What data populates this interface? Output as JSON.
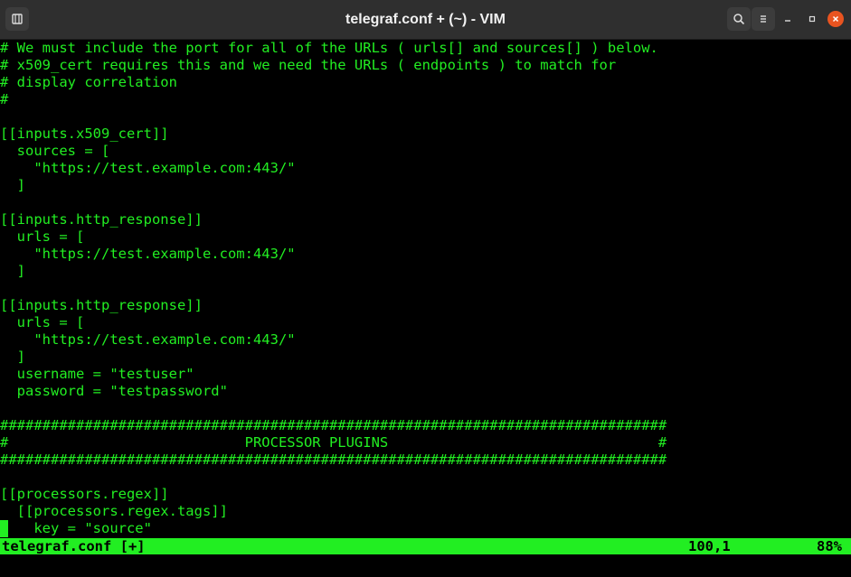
{
  "window": {
    "title": "telegraf.conf + (~) - VIM"
  },
  "icons": {
    "new_tab": "terminal-tab-icon",
    "search": "search-icon",
    "menu": "hamburger-menu-icon",
    "minimize": "minimize-icon",
    "maximize": "maximize-icon",
    "close": "close-icon"
  },
  "colors": {
    "text": "#22ee22",
    "background": "#000000",
    "titlebar": "#2f2f2f",
    "close_button": "#e95420"
  },
  "editor": {
    "lines": [
      "# We must include the port for all of the URLs ( urls[] and sources[] ) below.",
      "# x509_cert requires this and we need the URLs ( endpoints ) to match for",
      "# display correlation",
      "#",
      "",
      "[[inputs.x509_cert]]",
      "  sources = [",
      "    \"https://test.example.com:443/\"",
      "  ]",
      "",
      "[[inputs.http_response]]",
      "  urls = [",
      "    \"https://test.example.com:443/\"",
      "  ]",
      "",
      "[[inputs.http_response]]",
      "  urls = [",
      "    \"https://test.example.com:443/\"",
      "  ]",
      "  username = \"testuser\"",
      "  password = \"testpassword\"",
      "",
      "###############################################################################",
      "#                            PROCESSOR PLUGINS                                #",
      "###############################################################################",
      "",
      "[[processors.regex]]",
      "  [[processors.regex.tags]]",
      "    key = \"source\""
    ]
  },
  "status": {
    "filename": "telegraf.conf [+]",
    "position": "100,1",
    "percent": "88%"
  }
}
